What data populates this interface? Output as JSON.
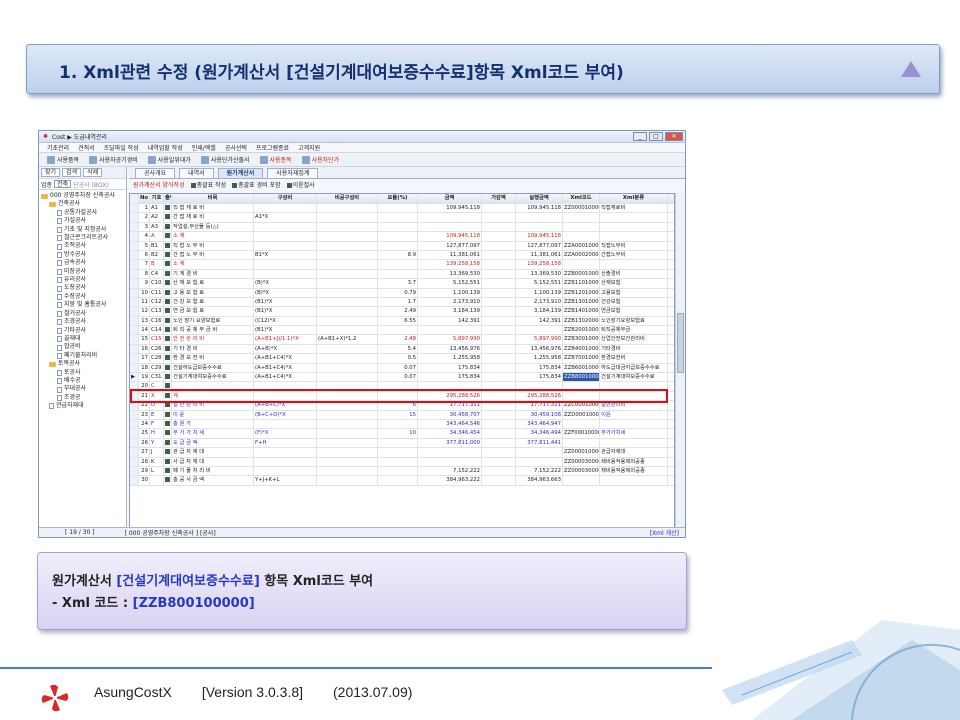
{
  "banner": {
    "title": "1. Xml관련 수정 (원가계산서 [건설기계대여보증수수료]항목 Xml코드 부여)"
  },
  "window": {
    "title": "Cost ▶ 도급내역관리",
    "menu": [
      "기초관리",
      "견적서",
      "조달파일 작성",
      "내역업할 작성",
      "인쇄/엑셀",
      "공사선택",
      "프로그램종료",
      "고객지원"
    ],
    "toolbar": [
      "사용품목",
      "사용자공기경비",
      "사용일위대가",
      "사용단가산출서",
      "사용종목",
      "사용자단가"
    ],
    "nav": [
      "찾기",
      "검색",
      "삭제"
    ],
    "select_label": "업종",
    "select_value": "건축",
    "select_hint": "단공사 (BOX)",
    "tree": [
      {
        "label": "000 공영주차장 신축공사",
        "level": 0,
        "type": "folder"
      },
      {
        "label": "건축공사",
        "level": 1,
        "type": "folder"
      },
      {
        "label": "공통가설공사",
        "level": 2,
        "type": "doc"
      },
      {
        "label": "가설공사",
        "level": 2,
        "type": "doc"
      },
      {
        "label": "기초 및 지정공사",
        "level": 2,
        "type": "doc"
      },
      {
        "label": "철근콘크리트공사",
        "level": 2,
        "type": "doc"
      },
      {
        "label": "조적공사",
        "level": 2,
        "type": "doc"
      },
      {
        "label": "방수공사",
        "level": 2,
        "type": "doc"
      },
      {
        "label": "금속공사",
        "level": 2,
        "type": "doc"
      },
      {
        "label": "미장공사",
        "level": 2,
        "type": "doc"
      },
      {
        "label": "유리공사",
        "level": 2,
        "type": "doc"
      },
      {
        "label": "도장공사",
        "level": 2,
        "type": "doc"
      },
      {
        "label": "수장공사",
        "level": 2,
        "type": "doc"
      },
      {
        "label": "지붕 및 홈통공사",
        "level": 2,
        "type": "doc"
      },
      {
        "label": "철거공사",
        "level": 2,
        "type": "doc"
      },
      {
        "label": "조경공사",
        "level": 2,
        "type": "doc"
      },
      {
        "label": "기타공사",
        "level": 2,
        "type": "doc"
      },
      {
        "label": "골재대",
        "level": 2,
        "type": "doc"
      },
      {
        "label": "잡공비",
        "level": 2,
        "type": "doc"
      },
      {
        "label": "폐기물처리비",
        "level": 2,
        "type": "doc"
      },
      {
        "label": "토목공사",
        "level": 1,
        "type": "folder"
      },
      {
        "label": "토공사",
        "level": 2,
        "type": "doc"
      },
      {
        "label": "배수공",
        "level": 2,
        "type": "doc"
      },
      {
        "label": "부대공사",
        "level": 2,
        "type": "doc"
      },
      {
        "label": "조경공",
        "level": 2,
        "type": "doc"
      },
      {
        "label": "관급자재대",
        "level": 1,
        "type": "doc"
      }
    ],
    "tabs": [
      "공사개요",
      "내역서",
      "원가계산서",
      "사용자재집계"
    ],
    "options_label": "원가계산서 양식작성",
    "options": [
      "총괄표 작성",
      "총괄표 경비 포함",
      "이윤절사"
    ],
    "columns": [
      "No",
      "기호",
      "출력",
      "비목",
      "구성비",
      "비공구성비",
      "요율(%)",
      "금액",
      "가감액",
      "실행금액",
      "Xml코드",
      "Xml분류"
    ],
    "rows": [
      {
        "no": "1",
        "code": "A1",
        "name": "직 접 재 료 비",
        "comp": "",
        "comp2": "",
        "rate": "",
        "amount": "109,945,118",
        "adj": "",
        "exec": "109,945,118",
        "xml": "ZZ0000100000",
        "cls": "직접재료비",
        "style": ""
      },
      {
        "no": "2",
        "code": "A2",
        "name": "간 접 재 료 비",
        "comp": "A1*X",
        "comp2": "",
        "rate": "",
        "amount": "",
        "adj": "",
        "exec": "",
        "xml": "",
        "cls": "",
        "style": ""
      },
      {
        "no": "3",
        "code": "A3",
        "name": "작업설,부산물 등(△)",
        "comp": "",
        "comp2": "",
        "rate": "",
        "amount": "",
        "adj": "",
        "exec": "",
        "xml": "",
        "cls": "",
        "style": ""
      },
      {
        "no": "4",
        "code": "A",
        "name": "소 계",
        "comp": "",
        "comp2": "",
        "rate": "",
        "amount": "109,945,118",
        "adj": "",
        "exec": "109,945,118",
        "xml": "",
        "cls": "",
        "style": "red"
      },
      {
        "no": "5",
        "code": "B1",
        "name": "직 접 노 무 비",
        "comp": "",
        "comp2": "",
        "rate": "",
        "amount": "127,877,097",
        "adj": "",
        "exec": "127,877,097",
        "xml": "ZZA000100000",
        "cls": "직접노무비",
        "style": ""
      },
      {
        "no": "6",
        "code": "B2",
        "name": "간 접 노 무 비",
        "comp": "B1*X",
        "comp2": "",
        "rate": "8.9",
        "amount": "11,381,061",
        "adj": "",
        "exec": "11,381,061",
        "xml": "ZZA000200000",
        "cls": "간접노무비",
        "style": ""
      },
      {
        "no": "7",
        "code": "B",
        "name": "소 계",
        "comp": "",
        "comp2": "",
        "rate": "",
        "amount": "139,258,158",
        "adj": "",
        "exec": "139,258,158",
        "xml": "",
        "cls": "",
        "style": "red"
      },
      {
        "no": "8",
        "code": "C4",
        "name": "기 계 경 비",
        "comp": "",
        "comp2": "",
        "rate": "",
        "amount": "13,369,530",
        "adj": "",
        "exec": "13,369,530",
        "xml": "ZZB000100000",
        "cls": "산출경비",
        "style": ""
      },
      {
        "no": "9",
        "code": "C10",
        "name": "산 재 보 험 료",
        "comp": "(B)*X",
        "comp2": "",
        "rate": "3.7",
        "amount": "5,152,551",
        "adj": "",
        "exec": "5,152,551",
        "xml": "ZZB110100000",
        "cls": "산재보험",
        "style": ""
      },
      {
        "no": "10",
        "code": "C11",
        "name": "고 용 보 험 료",
        "comp": "(B)*X",
        "comp2": "",
        "rate": "0.79",
        "amount": "1,100,139",
        "adj": "",
        "exec": "1,100,139",
        "xml": "ZZB120100000",
        "cls": "고용보험",
        "style": ""
      },
      {
        "no": "11",
        "code": "C12",
        "name": "건 강 보 험 료",
        "comp": "(B1)*X",
        "comp2": "",
        "rate": "1.7",
        "amount": "2,173,910",
        "adj": "",
        "exec": "2,173,910",
        "xml": "ZZB130100000",
        "cls": "건강보험",
        "style": ""
      },
      {
        "no": "12",
        "code": "C13",
        "name": "연 금 보 험 료",
        "comp": "(B1)*X",
        "comp2": "",
        "rate": "2.49",
        "amount": "3,184,139",
        "adj": "",
        "exec": "3,184,139",
        "xml": "ZZB140100000",
        "cls": "연금보험",
        "style": ""
      },
      {
        "no": "13",
        "code": "C16",
        "name": "노인 장기 요양보험료",
        "comp": "(C12)*X",
        "comp2": "",
        "rate": "6.55",
        "amount": "142,391",
        "adj": "",
        "exec": "142,391",
        "xml": "ZZB130200000",
        "cls": "노인장기요양보험료",
        "style": ""
      },
      {
        "no": "14",
        "code": "C14",
        "name": "퇴 직 공 제 부 금 비",
        "comp": "(B1)*X",
        "comp2": "",
        "rate": "",
        "amount": "",
        "adj": "",
        "exec": "",
        "xml": "ZZB200100000",
        "cls": "퇴직공제부금",
        "style": ""
      },
      {
        "no": "15",
        "code": "C15",
        "name": "안 전 관 리 비",
        "comp": "(A+B1+J)/1.1)*X",
        "comp2": "(A+B1+X)*1.2",
        "rate": "2.48",
        "amount": "5,897,990",
        "adj": "",
        "exec": "5,897,990",
        "xml": "ZZB300100000",
        "cls": "산업안전보건관리비",
        "style": "red"
      },
      {
        "no": "16",
        "code": "C26",
        "name": "기 타 경 비",
        "comp": "(A+B)*X",
        "comp2": "",
        "rate": "5.4",
        "amount": "13,456,976",
        "adj": "",
        "exec": "13,456,976",
        "xml": "ZZB400100000",
        "cls": "기타경비",
        "style": ""
      },
      {
        "no": "17",
        "code": "C28",
        "name": "환 경 보 전 비",
        "comp": "(A+B1+C4)*X",
        "comp2": "",
        "rate": "0.5",
        "amount": "1,255,958",
        "adj": "",
        "exec": "1,255,958",
        "xml": "ZZB700100000",
        "cls": "환경보전비",
        "style": ""
      },
      {
        "no": "18",
        "code": "C29",
        "name": "건설하도급보증수수료",
        "comp": "(A+B1+C4)*X",
        "comp2": "",
        "rate": "0.07",
        "amount": "175,834",
        "adj": "",
        "exec": "175,834",
        "xml": "ZZB600100000",
        "cls": "하도급대금지급보증수수료",
        "style": ""
      },
      {
        "no": "19",
        "code": "C31",
        "name": "건설기계대여보증수수료",
        "comp": "(A+B1+C4)*X",
        "comp2": "",
        "rate": "0.07",
        "amount": "175,834",
        "adj": "",
        "exec": "175,834",
        "xml": "ZZB800100000",
        "cls": "건설기계대여보증수수료",
        "style": "hl"
      },
      {
        "no": "20",
        "code": "C",
        "name": "",
        "comp": "",
        "comp2": "",
        "rate": "",
        "amount": "",
        "adj": "",
        "exec": "",
        "xml": "",
        "cls": "",
        "style": "red"
      },
      {
        "no": "21",
        "code": "X",
        "name": "계",
        "comp": "",
        "comp2": "",
        "rate": "",
        "amount": "295,288,526",
        "adj": "",
        "exec": "295,288,526",
        "xml": "",
        "cls": "",
        "style": "red"
      },
      {
        "no": "22",
        "code": "D",
        "name": "일 반 관 리 비",
        "comp": "(A+B+C)*X",
        "comp2": "",
        "rate": "6",
        "amount": "17,717,311",
        "adj": "",
        "exec": "17,717,311",
        "xml": "ZZC000100000",
        "cls": "일반관리비",
        "style": "blue"
      },
      {
        "no": "23",
        "code": "E",
        "name": "이 윤",
        "comp": "(B+C+D)*X",
        "comp2": "",
        "rate": "15",
        "amount": "30,458,707",
        "adj": "",
        "exec": "30,459,108",
        "xml": "ZZD000100000",
        "cls": "이윤",
        "style": "blue"
      },
      {
        "no": "24",
        "code": "F",
        "name": "총 원 가",
        "comp": "",
        "comp2": "",
        "rate": "",
        "amount": "343,464,546",
        "adj": "",
        "exec": "343,464,947",
        "xml": "",
        "cls": "",
        "style": "blue"
      },
      {
        "no": "25",
        "code": "H",
        "name": "부 가 가 치 세",
        "comp": "(F)*X",
        "comp2": "",
        "rate": "10",
        "amount": "34,346,454",
        "adj": "",
        "exec": "34,346,494",
        "xml": "ZZF000100000",
        "cls": "부가가치세",
        "style": "blue"
      },
      {
        "no": "26",
        "code": "Y",
        "name": "도 급 금 액",
        "comp": "F+H",
        "comp2": "",
        "rate": "",
        "amount": "377,811,000",
        "adj": "",
        "exec": "377,811,441",
        "xml": "",
        "cls": "",
        "style": "blue"
      },
      {
        "no": "27",
        "code": "J",
        "name": "관 급 자 재 대",
        "comp": "",
        "comp2": "",
        "rate": "",
        "amount": "",
        "adj": "",
        "exec": "",
        "xml": "ZZ0000100000",
        "cls": "관급자재대",
        "style": ""
      },
      {
        "no": "28",
        "code": "K",
        "name": "사 급 자 재 대",
        "comp": "",
        "comp2": "",
        "rate": "",
        "amount": "",
        "adj": "",
        "exec": "",
        "xml": "ZZ0000300000",
        "cls": "제비용적용제외공종",
        "style": ""
      },
      {
        "no": "29",
        "code": "L",
        "name": "폐 기 물 처 리 비",
        "comp": "",
        "comp2": "",
        "rate": "",
        "amount": "7,152,222",
        "adj": "",
        "exec": "7,152,222",
        "xml": "ZZ0000300000",
        "cls": "제비용적용제외공종",
        "style": ""
      },
      {
        "no": "30",
        "code": "",
        "name": "총 공 사 금 액",
        "comp": "Y+J+K+L",
        "comp2": "",
        "rate": "",
        "amount": "384,963,222",
        "adj": "",
        "exec": "384,963,663",
        "xml": "",
        "cls": "",
        "style": ""
      }
    ],
    "status_left": "[ 19 / 30 ]",
    "status_mid": "[ 000 공영주차장 신축공사 ] [공사]",
    "status_right": "[Xml 개산]"
  },
  "note": {
    "line1_a": "원가계산서 ",
    "line1_b": "[건설기계대여보증수수료]",
    "line1_c": " 항목 Xml코드 부여",
    "line2_a": " - Xml 코드 : ",
    "line2_b": "[ZZB800100000]"
  },
  "footer": {
    "app": "AsungCostX",
    "version": "[Version 3.0.3.8]",
    "date": "(2013.07.09)"
  },
  "colors": {
    "highlight_box": "#e00d0d",
    "banner_text": "#15306e",
    "note_accent": "#2539c4"
  }
}
